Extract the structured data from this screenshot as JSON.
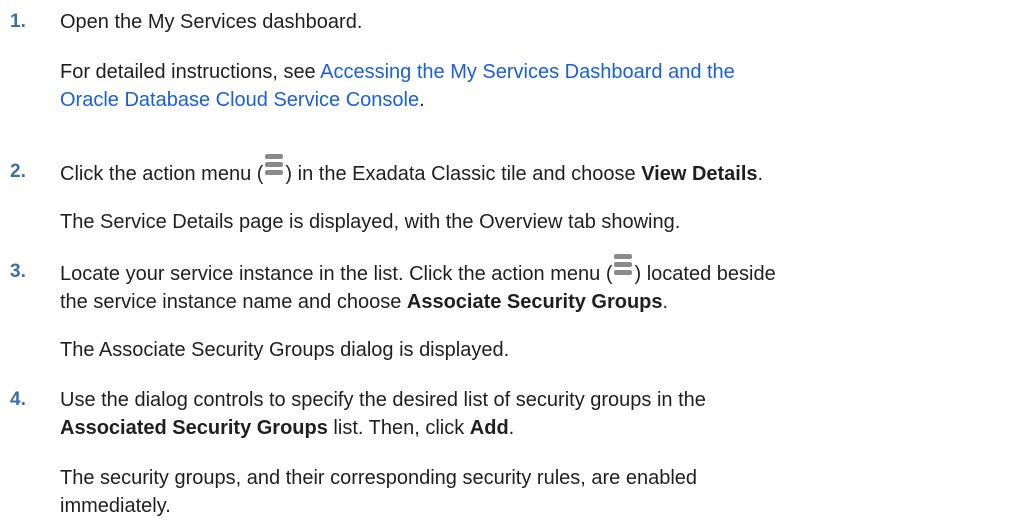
{
  "steps": [
    {
      "number": "1.",
      "text": "Open the My Services dashboard.",
      "detail_prefix": "For detailed instructions, see ",
      "detail_link_line1": "Accessing the My Services Dashboard and the",
      "detail_link_line2": "Oracle Database Cloud Service Console",
      "detail_suffix": "."
    },
    {
      "number": "2.",
      "text_before_icon": "Click the action menu (",
      "text_after_icon": ") in the Exadata Classic tile and choose ",
      "bold": "View Details",
      "text_end": ".",
      "result": "The Service Details page is displayed, with the Overview tab showing."
    },
    {
      "number": "3.",
      "text_before_icon": "Locate your service instance in the list. Click the action menu (",
      "text_after_icon": ") located beside",
      "line2_prefix": "the service instance name and choose ",
      "bold": "Associate Security Groups",
      "text_end": ".",
      "result": "The Associate Security Groups dialog is displayed."
    },
    {
      "number": "4.",
      "line1": "Use the dialog controls to specify the desired list of security groups in the",
      "bold1": "Associated Security Groups",
      "line2_mid": " list. Then, click ",
      "bold2": "Add",
      "text_end": ".",
      "result_line1": "The security groups, and their corresponding security rules, are enabled",
      "result_line2": "immediately."
    }
  ],
  "icons": {
    "action_menu": "hamburger-menu-icon",
    "icon_color": "#8a8a8a"
  }
}
